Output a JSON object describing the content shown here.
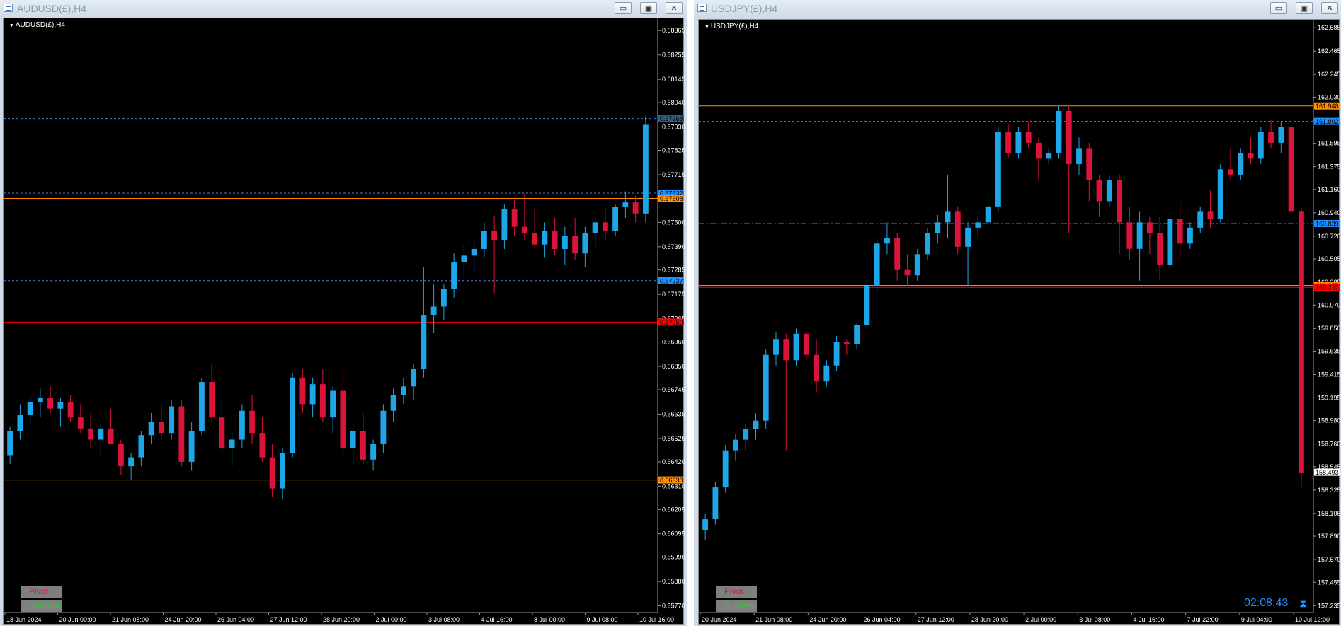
{
  "windows": [
    {
      "title": "AUDUSD(£),H4",
      "symbol_label": "AUDUSD(£),H4",
      "buttons": {
        "minimize": "▭",
        "maximize": "▣",
        "close": "✕"
      },
      "indicators": [
        "Pivot",
        "SupRes"
      ],
      "colors": {
        "bull": "#1ea7e8",
        "bear": "#dc143c",
        "pivot": "#dc143c",
        "supres": "#32cd32"
      },
      "chart_data": {
        "type": "candlestick",
        "ylim": [
          0.6574,
          0.6842
        ],
        "y_ticks": [
          "0.68365",
          "0.68255",
          "0.68145",
          "0.68040",
          "0.67930",
          "0.67825",
          "0.67715",
          "0.67500",
          "0.67390",
          "0.67285",
          "0.67175",
          "0.67065",
          "0.66960",
          "0.66850",
          "0.66745",
          "0.66635",
          "0.66525",
          "0.66420",
          "0.66310",
          "0.66205",
          "0.66095",
          "0.65990",
          "0.65880",
          "0.65770"
        ],
        "x_labels": [
          "18 Jun 2024",
          "20 Jun 00:00",
          "21 Jun 08:00",
          "24 Jun 20:00",
          "26 Jun 04:00",
          "27 Jun 12:00",
          "28 Jun 20:00",
          "2 Jul 00:00",
          "3 Jul 08:00",
          "4 Jul 16:00",
          "8 Jul 00:00",
          "9 Jul 08:00",
          "10 Jul 16:00"
        ],
        "levels": [
          {
            "value": 0.67968,
            "label": "0.67968",
            "style": "dashed",
            "color": "#4a7fd4",
            "tag_bg": "#2f5f7f"
          },
          {
            "value": 0.67632,
            "label": "0.67632",
            "style": "dashed",
            "color": "#4a7fd4",
            "tag_bg": "#1e90ff"
          },
          {
            "value": 0.67608,
            "label": "0.67608",
            "style": "solid",
            "color": "#ff8c00",
            "tag_bg": "#ff8c00"
          },
          {
            "value": 0.67237,
            "label": "0.67237",
            "style": "dashed",
            "color": "#4a7fd4",
            "tag_bg": "#1e90ff"
          },
          {
            "value": 0.6705,
            "label": "0.67050",
            "style": "solid",
            "color": "#ff0000",
            "tag_bg": "#ff0000"
          },
          {
            "value": 0.66338,
            "label": "0.66338",
            "style": "solid",
            "color": "#ff8c00",
            "tag_bg": "#ff8c00"
          }
        ],
        "candles": [
          [
            0.6645,
            0.6658,
            0.6641,
            0.6656
          ],
          [
            0.6656,
            0.6668,
            0.6652,
            0.6663
          ],
          [
            0.6663,
            0.6672,
            0.6659,
            0.6669
          ],
          [
            0.6669,
            0.6675,
            0.6662,
            0.6671
          ],
          [
            0.6671,
            0.6676,
            0.6664,
            0.6666
          ],
          [
            0.6666,
            0.6671,
            0.6658,
            0.6669
          ],
          [
            0.6669,
            0.6672,
            0.666,
            0.6662
          ],
          [
            0.6662,
            0.6668,
            0.6655,
            0.6657
          ],
          [
            0.6657,
            0.6664,
            0.6648,
            0.6652
          ],
          [
            0.6652,
            0.666,
            0.6645,
            0.6657
          ],
          [
            0.6657,
            0.6666,
            0.665,
            0.665
          ],
          [
            0.665,
            0.6652,
            0.6636,
            0.664
          ],
          [
            0.664,
            0.6646,
            0.6634,
            0.6644
          ],
          [
            0.6644,
            0.6656,
            0.664,
            0.6654
          ],
          [
            0.6654,
            0.6664,
            0.665,
            0.666
          ],
          [
            0.666,
            0.6668,
            0.6652,
            0.6655
          ],
          [
            0.6655,
            0.667,
            0.6652,
            0.6667
          ],
          [
            0.6667,
            0.667,
            0.664,
            0.6642
          ],
          [
            0.6642,
            0.666,
            0.6638,
            0.6656
          ],
          [
            0.6656,
            0.668,
            0.6654,
            0.6678
          ],
          [
            0.6678,
            0.6686,
            0.666,
            0.6662
          ],
          [
            0.6662,
            0.667,
            0.6646,
            0.6648
          ],
          [
            0.6648,
            0.6655,
            0.664,
            0.6652
          ],
          [
            0.6652,
            0.6668,
            0.6648,
            0.6665
          ],
          [
            0.6665,
            0.6672,
            0.665,
            0.6655
          ],
          [
            0.6655,
            0.6662,
            0.6642,
            0.6644
          ],
          [
            0.6644,
            0.665,
            0.6626,
            0.663
          ],
          [
            0.663,
            0.6648,
            0.6625,
            0.6646
          ],
          [
            0.6646,
            0.6682,
            0.6644,
            0.668
          ],
          [
            0.668,
            0.6684,
            0.6664,
            0.6668
          ],
          [
            0.6668,
            0.668,
            0.6662,
            0.6677
          ],
          [
            0.6677,
            0.6684,
            0.666,
            0.6662
          ],
          [
            0.6662,
            0.6676,
            0.6655,
            0.6674
          ],
          [
            0.6674,
            0.6684,
            0.6645,
            0.6648
          ],
          [
            0.6648,
            0.666,
            0.664,
            0.6656
          ],
          [
            0.6656,
            0.6664,
            0.6641,
            0.6643
          ],
          [
            0.6643,
            0.6652,
            0.6638,
            0.665
          ],
          [
            0.665,
            0.6668,
            0.6646,
            0.6665
          ],
          [
            0.6665,
            0.6675,
            0.666,
            0.6672
          ],
          [
            0.6672,
            0.668,
            0.6668,
            0.6676
          ],
          [
            0.6676,
            0.6686,
            0.667,
            0.6684
          ],
          [
            0.6684,
            0.673,
            0.668,
            0.6708
          ],
          [
            0.6708,
            0.6722,
            0.67,
            0.6712
          ],
          [
            0.6712,
            0.6722,
            0.6706,
            0.672
          ],
          [
            0.672,
            0.6736,
            0.6716,
            0.6732
          ],
          [
            0.6732,
            0.674,
            0.6725,
            0.6735
          ],
          [
            0.6735,
            0.6742,
            0.6728,
            0.6738
          ],
          [
            0.6738,
            0.675,
            0.6734,
            0.6746
          ],
          [
            0.6746,
            0.6753,
            0.6718,
            0.6742
          ],
          [
            0.6742,
            0.6758,
            0.6738,
            0.6756
          ],
          [
            0.6756,
            0.676,
            0.6744,
            0.6748
          ],
          [
            0.6748,
            0.6763,
            0.6742,
            0.6745
          ],
          [
            0.6745,
            0.6756,
            0.6738,
            0.674
          ],
          [
            0.674,
            0.675,
            0.6734,
            0.6746
          ],
          [
            0.6746,
            0.6752,
            0.6735,
            0.6738
          ],
          [
            0.6738,
            0.6748,
            0.6731,
            0.6744
          ],
          [
            0.6744,
            0.6752,
            0.6733,
            0.6736
          ],
          [
            0.6736,
            0.6748,
            0.673,
            0.6745
          ],
          [
            0.6745,
            0.6752,
            0.6738,
            0.675
          ],
          [
            0.675,
            0.6756,
            0.6742,
            0.6746
          ],
          [
            0.6746,
            0.6758,
            0.6744,
            0.6757
          ],
          [
            0.6757,
            0.6764,
            0.6752,
            0.6759
          ],
          [
            0.6759,
            0.6762,
            0.675,
            0.6754
          ],
          [
            0.6754,
            0.6798,
            0.675,
            0.6794
          ]
        ]
      }
    },
    {
      "title": "USDJPY(£),H4",
      "symbol_label": "USDJPY(£),H4",
      "buttons": {
        "minimize": "▭",
        "maximize": "▣",
        "close": "✕"
      },
      "indicators": [
        "Pivot",
        "SupRes"
      ],
      "timer": "02:08:43",
      "colors": {
        "bull": "#1ea7e8",
        "bear": "#dc143c",
        "pivot": "#dc143c",
        "supres": "#32cd32"
      },
      "chart_data": {
        "type": "candlestick",
        "ylim": [
          157.17,
          162.76
        ],
        "y_ticks": [
          "162.685",
          "162.465",
          "162.245",
          "162.030",
          "161.810",
          "161.595",
          "161.375",
          "161.160",
          "160.940",
          "160.720",
          "160.505",
          "160.285",
          "160.070",
          "159.850",
          "159.635",
          "159.415",
          "159.195",
          "158.980",
          "158.760",
          "158.545",
          "158.325",
          "158.105",
          "157.890",
          "157.670",
          "157.455",
          "157.235"
        ],
        "x_labels": [
          "20 Jun 2024",
          "21 Jun 08:00",
          "24 Jun 20:00",
          "26 Jun 04:00",
          "27 Jun 12:00",
          "28 Jun 20:00",
          "2 Jul 00:00",
          "3 Jul 08:00",
          "4 Jul 16:00",
          "7 Jul 22:00",
          "9 Jul 04:00",
          "10 Jul 12:00"
        ],
        "levels": [
          {
            "value": 161.948,
            "label": "161.948",
            "style": "solid",
            "color": "#ff8c00",
            "tag_bg": "#ff8c00"
          },
          {
            "value": 161.802,
            "label": "161.802",
            "style": "dashed",
            "color": "#4a7fd4",
            "tag_bg": "#1e90ff"
          },
          {
            "value": 160.839,
            "label": "160.839",
            "style": "dashdot",
            "color": "#4a7fd4",
            "tag_bg": "#1e90ff"
          },
          {
            "value": 160.255,
            "label": "160.255",
            "style": "solid",
            "color": "#ff8c00",
            "tag_bg": "#ff8c00"
          },
          {
            "value": 160.237,
            "label": "160.237",
            "style": "solid",
            "color": "#ff0000",
            "tag_bg": "#ff0000"
          },
          {
            "value": 158.493,
            "label": "158.493",
            "style": "none",
            "color": "#ffffff",
            "tag_bg": "#ffffff"
          }
        ],
        "candles": [
          [
            157.95,
            158.1,
            157.85,
            158.05
          ],
          [
            158.05,
            158.4,
            158.0,
            158.35
          ],
          [
            158.35,
            158.75,
            158.3,
            158.7
          ],
          [
            158.7,
            158.85,
            158.6,
            158.8
          ],
          [
            158.8,
            158.95,
            158.7,
            158.9
          ],
          [
            158.9,
            159.05,
            158.8,
            158.98
          ],
          [
            158.98,
            159.65,
            158.9,
            159.6
          ],
          [
            159.6,
            159.82,
            159.5,
            159.75
          ],
          [
            159.75,
            159.8,
            158.7,
            159.55
          ],
          [
            159.55,
            159.85,
            159.5,
            159.8
          ],
          [
            159.8,
            159.82,
            159.55,
            159.6
          ],
          [
            159.6,
            159.75,
            159.25,
            159.35
          ],
          [
            159.35,
            159.55,
            159.3,
            159.5
          ],
          [
            159.5,
            159.78,
            159.45,
            159.72
          ],
          [
            159.72,
            159.75,
            159.6,
            159.7
          ],
          [
            159.7,
            159.9,
            159.65,
            159.88
          ],
          [
            159.88,
            160.3,
            159.85,
            160.25
          ],
          [
            160.25,
            160.7,
            160.2,
            160.65
          ],
          [
            160.65,
            160.85,
            160.55,
            160.7
          ],
          [
            160.7,
            160.75,
            160.3,
            160.4
          ],
          [
            160.4,
            160.55,
            160.25,
            160.35
          ],
          [
            160.35,
            160.6,
            160.3,
            160.55
          ],
          [
            160.55,
            160.8,
            160.5,
            160.75
          ],
          [
            160.75,
            160.92,
            160.65,
            160.85
          ],
          [
            160.85,
            161.3,
            160.7,
            160.95
          ],
          [
            160.95,
            161.0,
            160.55,
            160.62
          ],
          [
            160.62,
            160.85,
            160.25,
            160.8
          ],
          [
            160.8,
            160.9,
            160.7,
            160.85
          ],
          [
            160.85,
            161.1,
            160.8,
            161.0
          ],
          [
            161.0,
            161.75,
            160.95,
            161.7
          ],
          [
            161.7,
            161.78,
            161.45,
            161.5
          ],
          [
            161.5,
            161.75,
            161.45,
            161.7
          ],
          [
            161.7,
            161.8,
            161.55,
            161.6
          ],
          [
            161.6,
            161.65,
            161.25,
            161.45
          ],
          [
            161.45,
            161.55,
            161.4,
            161.5
          ],
          [
            161.5,
            161.95,
            161.45,
            161.9
          ],
          [
            161.9,
            161.95,
            160.75,
            161.4
          ],
          [
            161.4,
            161.65,
            161.3,
            161.55
          ],
          [
            161.55,
            161.6,
            161.05,
            161.25
          ],
          [
            161.25,
            161.3,
            160.9,
            161.05
          ],
          [
            161.05,
            161.3,
            161.0,
            161.25
          ],
          [
            161.25,
            161.3,
            160.55,
            160.85
          ],
          [
            160.85,
            161.0,
            160.5,
            160.6
          ],
          [
            160.6,
            160.95,
            160.3,
            160.85
          ],
          [
            160.85,
            160.9,
            160.55,
            160.75
          ],
          [
            160.75,
            160.9,
            160.3,
            160.45
          ],
          [
            160.45,
            160.95,
            160.4,
            160.88
          ],
          [
            160.88,
            161.05,
            160.5,
            160.65
          ],
          [
            160.65,
            160.85,
            160.6,
            160.8
          ],
          [
            160.8,
            161.0,
            160.75,
            160.95
          ],
          [
            160.95,
            161.15,
            160.8,
            160.88
          ],
          [
            160.88,
            161.4,
            160.85,
            161.35
          ],
          [
            161.35,
            161.55,
            161.25,
            161.3
          ],
          [
            161.3,
            161.55,
            161.25,
            161.5
          ],
          [
            161.5,
            161.65,
            161.4,
            161.45
          ],
          [
            161.45,
            161.75,
            161.4,
            161.7
          ],
          [
            161.7,
            161.82,
            161.55,
            161.6
          ],
          [
            161.6,
            161.8,
            161.5,
            161.75
          ],
          [
            161.75,
            161.78,
            160.95,
            160.95
          ],
          [
            160.95,
            161.0,
            158.35,
            158.49
          ]
        ]
      }
    }
  ]
}
